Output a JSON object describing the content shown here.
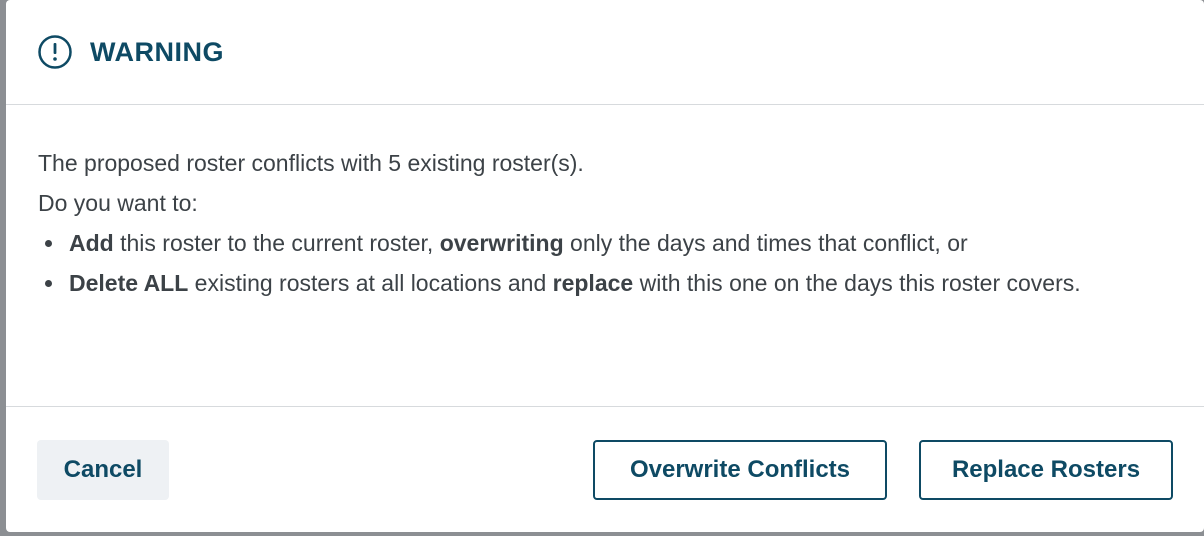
{
  "dialog": {
    "title": "WARNING",
    "icon": "exclamation-circle-icon",
    "accent_color": "#0e4a64",
    "message_line1": "The proposed roster conflicts with 5 existing roster(s).",
    "message_line2": "Do you want to:",
    "options": [
      {
        "parts": [
          {
            "text": "Add",
            "bold": true
          },
          {
            "text": " this roster to the current roster, ",
            "bold": false
          },
          {
            "text": "overwriting",
            "bold": true
          },
          {
            "text": " only the days and times that conflict, or",
            "bold": false
          }
        ]
      },
      {
        "parts": [
          {
            "text": "Delete ALL",
            "bold": true
          },
          {
            "text": " existing rosters at all locations and ",
            "bold": false
          },
          {
            "text": "replace",
            "bold": true
          },
          {
            "text": " with this one on the days this roster covers.",
            "bold": false
          }
        ]
      }
    ]
  },
  "footer": {
    "cancel_label": "Cancel",
    "overwrite_label": "Overwrite Conflicts",
    "replace_label": "Replace Rosters"
  }
}
